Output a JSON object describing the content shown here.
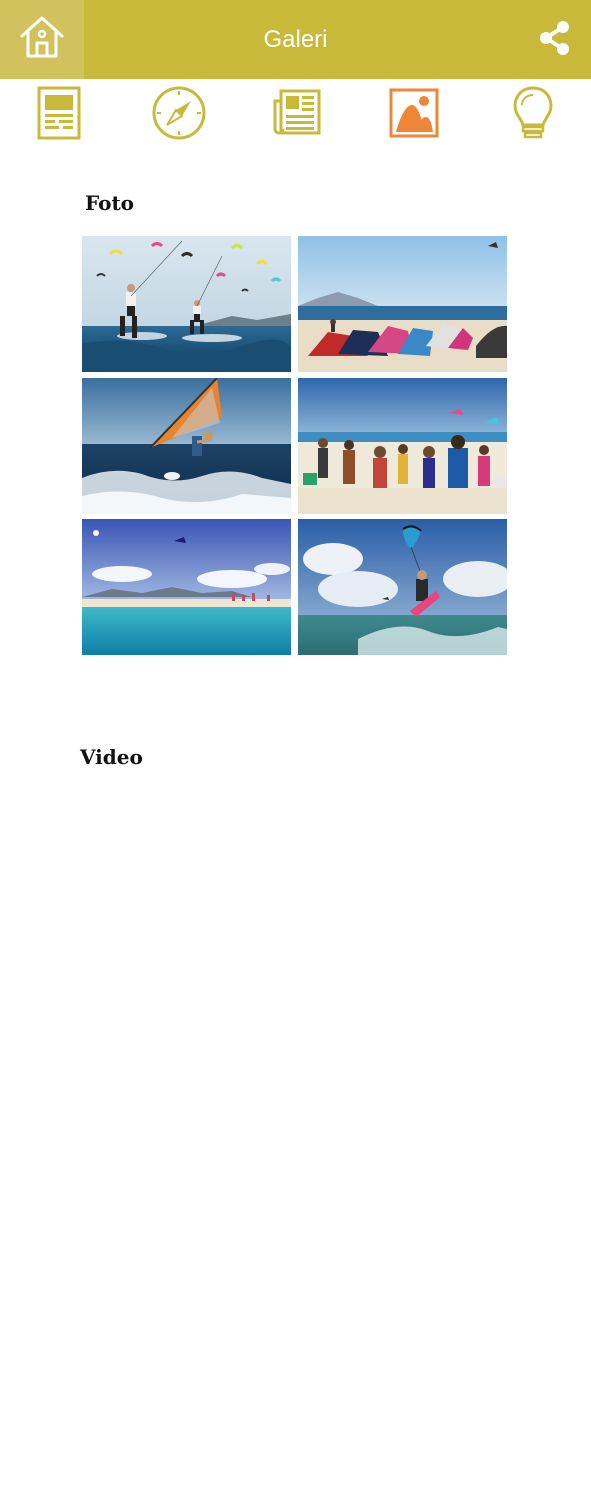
{
  "header": {
    "title": "Galeri",
    "home_icon": "home-icon",
    "share_icon": "share-icon",
    "bg_color": "#c9b93b"
  },
  "toolbar": {
    "items": [
      {
        "icon": "document-icon",
        "active": false
      },
      {
        "icon": "compass-icon",
        "active": false
      },
      {
        "icon": "newspaper-icon",
        "active": false
      },
      {
        "icon": "image-gallery-icon",
        "active": true
      },
      {
        "icon": "lightbulb-icon",
        "active": false
      }
    ],
    "color": "#c9b93b",
    "active_color": "#ee8638"
  },
  "gallery": {
    "photo_label": "Foto",
    "video_label": "Video",
    "photos": [
      {
        "name": "kitesurfers-on-sea"
      },
      {
        "name": "kites-on-beach"
      },
      {
        "name": "windsurfer-jump"
      },
      {
        "name": "beach-crowd-with-kites"
      },
      {
        "name": "tropical-beach-sea"
      },
      {
        "name": "kitesurfer-jump-turquoise"
      }
    ]
  }
}
